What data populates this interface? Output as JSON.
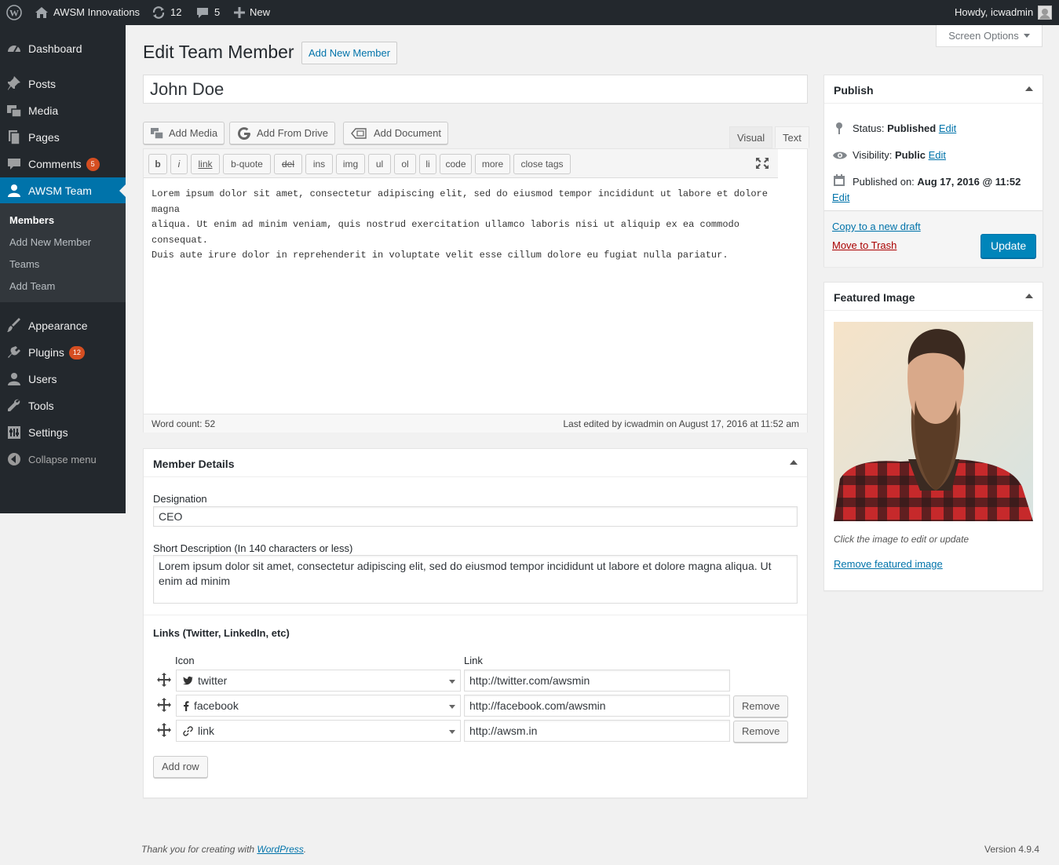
{
  "admin_bar": {
    "site_name": "AWSM Innovations",
    "updates_count": "12",
    "comments_count": "5",
    "new_label": "New",
    "howdy": "Howdy, icwadmin"
  },
  "sidebar": {
    "items": [
      {
        "label": "Dashboard",
        "icon": "dashboard-icon"
      },
      {
        "label": "Posts",
        "icon": "pin-icon"
      },
      {
        "label": "Media",
        "icon": "media-icon"
      },
      {
        "label": "Pages",
        "icon": "pages-icon"
      },
      {
        "label": "Comments",
        "icon": "comment-icon",
        "badge": "5"
      },
      {
        "label": "AWSM Team",
        "icon": "user-icon"
      },
      {
        "label": "Appearance",
        "icon": "brush-icon"
      },
      {
        "label": "Plugins",
        "icon": "plugin-icon",
        "badge": "12"
      },
      {
        "label": "Users",
        "icon": "users-icon"
      },
      {
        "label": "Tools",
        "icon": "wrench-icon"
      },
      {
        "label": "Settings",
        "icon": "settings-icon"
      }
    ],
    "submenu": [
      "Members",
      "Add New Member",
      "Teams",
      "Add Team"
    ],
    "collapse": "Collapse menu"
  },
  "header": {
    "title": "Edit Team Member",
    "add_new": "Add New Member",
    "screen_options": "Screen Options"
  },
  "post_title": "John Doe",
  "media_buttons": {
    "add_media": "Add Media",
    "add_from_drive": "Add From Drive",
    "add_document": "Add Document"
  },
  "editor_tabs": {
    "visual": "Visual",
    "text": "Text"
  },
  "quicktags": [
    "b",
    "i",
    "link",
    "b-quote",
    "del",
    "ins",
    "img",
    "ul",
    "ol",
    "li",
    "code",
    "more",
    "close tags"
  ],
  "editor": {
    "lines": [
      "Lorem ipsum dolor sit amet, consectetur adipiscing elit, sed do eiusmod tempor incididunt ut labore et dolore magna",
      "aliqua. Ut enim ad minim veniam, quis nostrud exercitation ullamco laboris nisi ut aliquip ex ea commodo consequat.",
      "Duis aute irure dolor in reprehenderit in voluptate velit esse cillum dolore eu fugiat nulla pariatur."
    ],
    "word_count": "Word count: 52",
    "last_edited": "Last edited by icwadmin on August 17, 2016 at 11:52 am"
  },
  "member_details": {
    "title": "Member Details",
    "designation_label": "Designation",
    "designation_value": "CEO",
    "short_desc_label": "Short Description (In 140 characters or less)",
    "short_desc_value": "Lorem ipsum dolor sit amet, consectetur adipiscing elit, sed do eiusmod tempor incididunt ut labore et dolore magna aliqua. Ut enim ad minim",
    "links_title": "Links (Twitter, LinkedIn, etc)",
    "col_icon": "Icon",
    "col_link": "Link",
    "links": [
      {
        "icon": "twitter",
        "url": "http://twitter.com/awsmin"
      },
      {
        "icon": "facebook",
        "url": "http://facebook.com/awsmin",
        "remove": "Remove"
      },
      {
        "icon": "link",
        "url": "http://awsm.in",
        "remove": "Remove"
      }
    ],
    "add_row": "Add row"
  },
  "publish": {
    "title": "Publish",
    "status_label": "Status:",
    "status_value": "Published",
    "visibility_label": "Visibility:",
    "visibility_value": "Public",
    "published_label": "Published on:",
    "published_value": "Aug 17, 2016 @ 11:52",
    "edit": "Edit",
    "copy_draft": "Copy to a new draft",
    "move_trash": "Move to Trash",
    "update": "Update"
  },
  "featured_image": {
    "title": "Featured Image",
    "hint": "Click the image to edit or update",
    "remove": "Remove featured image"
  },
  "footer": {
    "thanks": "Thank you for creating with ",
    "wp_link": "WordPress",
    "version": "Version 4.9.4"
  },
  "colors": {
    "admin_bar": "#23282d",
    "accent": "#0073aa",
    "primary_button": "#0085ba",
    "badge": "#d54e21",
    "trash": "#a00"
  }
}
